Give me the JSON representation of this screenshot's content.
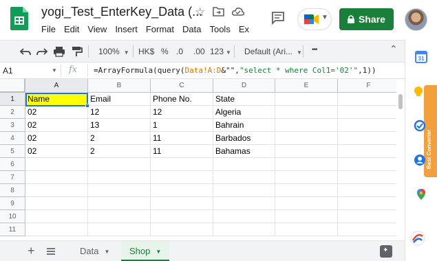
{
  "document": {
    "title": "yogi_Test_EnterKey_Data (...",
    "menu": [
      "File",
      "Edit",
      "View",
      "Insert",
      "Format",
      "Data",
      "Tools",
      "Ex"
    ]
  },
  "header": {
    "share_label": "Share"
  },
  "toolbar": {
    "zoom": "100%",
    "currency": "HK$",
    "percent": "%",
    "decrease_decimals": ".0",
    "increase_decimals": ".00",
    "more_formats": "123",
    "font": "Default (Ari...",
    "more": "•••"
  },
  "formula_bar": {
    "cell_ref": "A1",
    "fx": "fx",
    "formula_parts": [
      {
        "text": "=ArrayFormula(query(",
        "kind": "plain"
      },
      {
        "text": "Data!A:D",
        "kind": "ref"
      },
      {
        "text": "&\"\",",
        "kind": "plain"
      },
      {
        "text": "\"select * where Col1='02'\"",
        "kind": "str"
      },
      {
        "text": ",1))",
        "kind": "plain"
      }
    ]
  },
  "grid": {
    "columns": [
      "A",
      "B",
      "C",
      "D",
      "E",
      "F"
    ],
    "row_numbers": [
      "1",
      "2",
      "3",
      "4",
      "5",
      "6",
      "7",
      "8",
      "9",
      "10",
      "11"
    ],
    "rows": [
      [
        "Name",
        "Email",
        "Phone No.",
        "State",
        "",
        ""
      ],
      [
        "02",
        "12",
        "12",
        "Algeria",
        "",
        ""
      ],
      [
        "02",
        "13",
        "1",
        "Bahrain",
        "",
        ""
      ],
      [
        "02",
        "2",
        "11",
        "Barbados",
        "",
        ""
      ],
      [
        "02",
        "2",
        "11",
        "Bahamas",
        "",
        ""
      ],
      [
        "",
        "",
        "",
        "",
        "",
        ""
      ],
      [
        "",
        "",
        "",
        "",
        "",
        ""
      ],
      [
        "",
        "",
        "",
        "",
        "",
        ""
      ],
      [
        "",
        "",
        "",
        "",
        "",
        ""
      ],
      [
        "",
        "",
        "",
        "",
        "",
        ""
      ],
      [
        "",
        "",
        "",
        "",
        "",
        ""
      ]
    ],
    "active_cell": "A1",
    "highlight_color": "#ffff00"
  },
  "sheets": {
    "tabs": [
      "Data",
      "Shop"
    ],
    "active": "Shop"
  },
  "side_panel": {
    "extension_label": "Best Converter"
  },
  "colors": {
    "accent_green": "#188038",
    "selection_blue": "#1a73e8"
  }
}
